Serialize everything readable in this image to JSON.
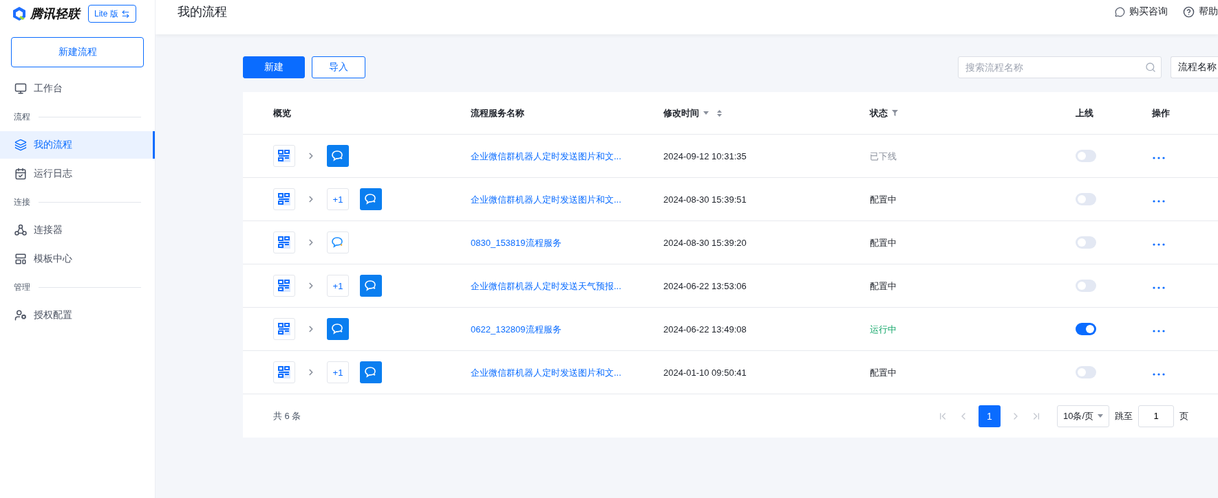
{
  "sidebar": {
    "brand": "腾讯轻联",
    "edition_button": "Lite 版",
    "new_button": "新建流程",
    "items": [
      {
        "kind": "item",
        "label": "工作台",
        "selected": false
      },
      {
        "kind": "section",
        "label": "流程"
      },
      {
        "kind": "item",
        "label": "我的流程",
        "selected": true
      },
      {
        "kind": "item",
        "label": "运行日志",
        "selected": false
      },
      {
        "kind": "section",
        "label": "连接"
      },
      {
        "kind": "item",
        "label": "连接器",
        "selected": false
      },
      {
        "kind": "item",
        "label": "模板中心",
        "selected": false
      },
      {
        "kind": "section",
        "label": "管理"
      },
      {
        "kind": "item",
        "label": "授权配置",
        "selected": false
      }
    ]
  },
  "header": {
    "title": "我的流程",
    "links": [
      "购买咨询",
      "帮助"
    ]
  },
  "toolbar": {
    "primary_button": "新建",
    "secondary_button": "导入",
    "search": {
      "placeholder": "搜索流程名称"
    },
    "filter_select": "流程名称"
  },
  "table": {
    "columns": [
      "概览",
      "流程服务名称",
      "修改时间",
      "状态",
      "上线",
      "操作"
    ],
    "rows": [
      {
        "extra": null,
        "action": {
          "kind": "filled"
        },
        "name": "企业微信群机器人定时发送图片和文...",
        "modified": "2024-09-12 10:31:35",
        "status": {
          "text": "已下线",
          "kind": "offline"
        },
        "online": false
      },
      {
        "extra": "+1",
        "action": {
          "kind": "filled"
        },
        "name": "企业微信群机器人定时发送图片和文...",
        "modified": "2024-08-30 15:39:51",
        "status": {
          "text": "配置中",
          "kind": "configuring"
        },
        "online": false
      },
      {
        "extra": null,
        "action": {
          "kind": "outline"
        },
        "name": "0830_153819流程服务",
        "modified": "2024-08-30 15:39:20",
        "status": {
          "text": "配置中",
          "kind": "configuring"
        },
        "online": false
      },
      {
        "extra": "+1",
        "action": {
          "kind": "filled"
        },
        "name": "企业微信群机器人定时发送天气预报...",
        "modified": "2024-06-22 13:53:06",
        "status": {
          "text": "配置中",
          "kind": "configuring"
        },
        "online": false
      },
      {
        "extra": null,
        "action": {
          "kind": "filled"
        },
        "name": "0622_132809流程服务",
        "modified": "2024-06-22 13:49:08",
        "status": {
          "text": "运行中",
          "kind": "running"
        },
        "online": true
      },
      {
        "extra": "+1",
        "action": {
          "kind": "filled"
        },
        "name": "企业微信群机器人定时发送图片和文...",
        "modified": "2024-01-10 09:50:41",
        "status": {
          "text": "配置中",
          "kind": "configuring"
        },
        "online": false
      }
    ]
  },
  "pagination": {
    "total": "共 6 条",
    "pages": [
      {
        "label": "1",
        "selected": true
      }
    ],
    "page_size": "10条/页",
    "jump_label": "跳至",
    "jump_value": "1",
    "page_suffix": "页"
  }
}
